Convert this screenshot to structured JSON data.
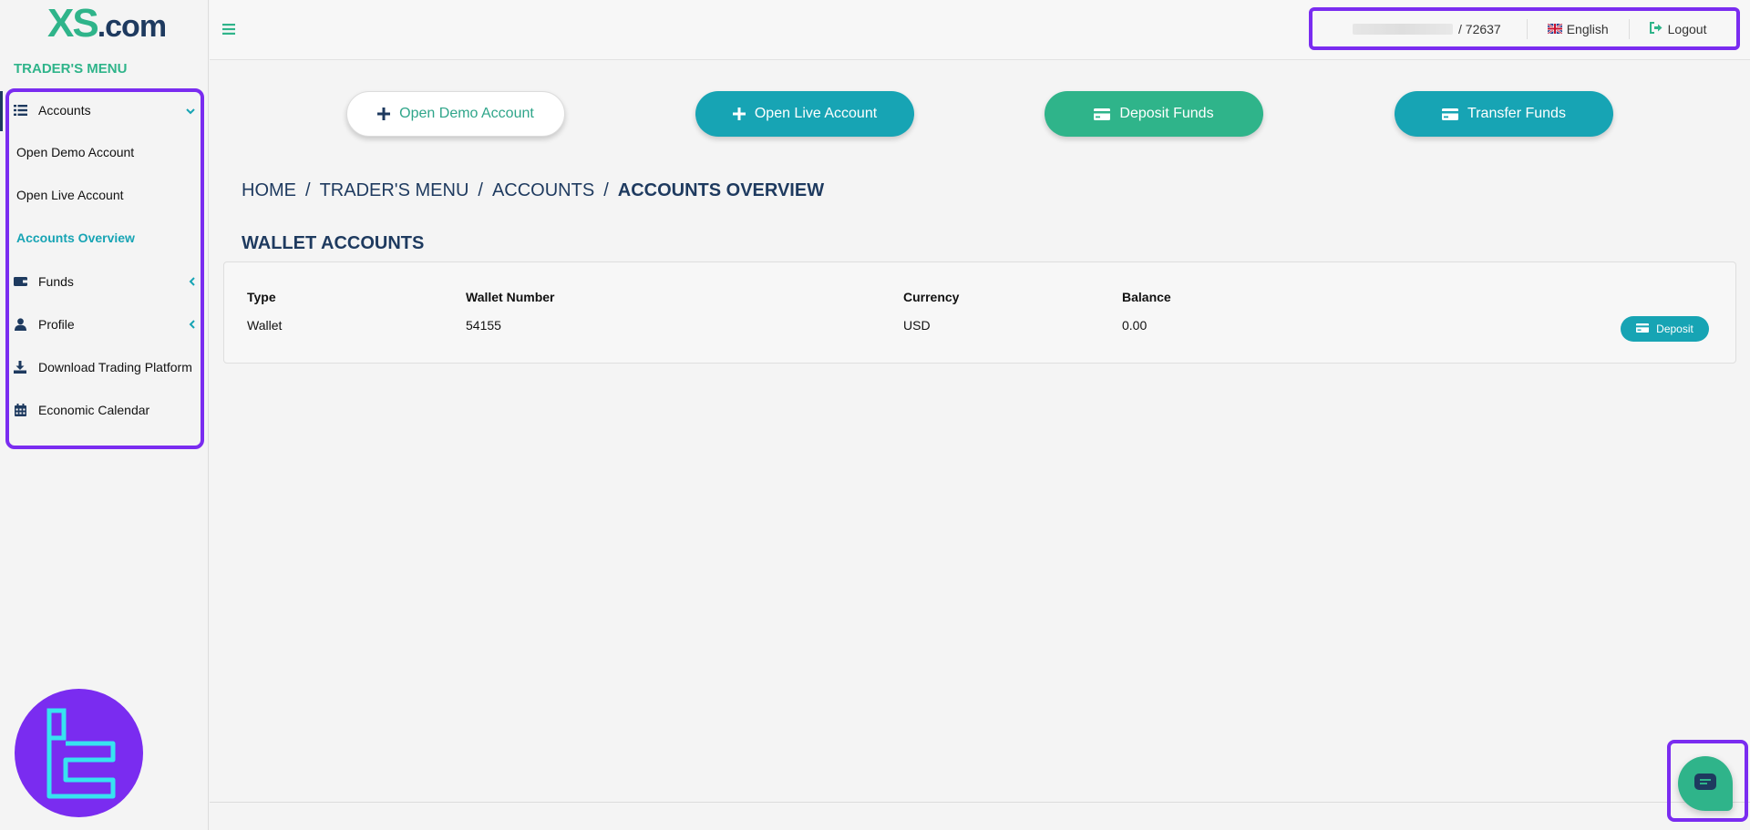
{
  "brand": {
    "logo_main": "XS",
    "logo_suffix": ".com"
  },
  "sidebar": {
    "title": "TRADER'S MENU",
    "accounts_label": "Accounts",
    "sub_items": [
      {
        "label": "Open Demo Account"
      },
      {
        "label": "Open Live Account"
      },
      {
        "label": "Accounts Overview"
      }
    ],
    "funds_label": "Funds",
    "profile_label": "Profile",
    "download_label": "Download Trading Platform",
    "calendar_label": "Economic Calendar"
  },
  "topbar": {
    "account_suffix": "/ 72637",
    "language": "English",
    "logout": "Logout"
  },
  "actions": {
    "open_demo": "Open Demo Account",
    "open_live": "Open Live Account",
    "deposit_funds": "Deposit Funds",
    "transfer_funds": "Transfer Funds"
  },
  "breadcrumb": {
    "home": "HOME",
    "traders_menu": "TRADER'S MENU",
    "accounts": "ACCOUNTS",
    "current": "ACCOUNTS OVERVIEW"
  },
  "wallet": {
    "section_title": "WALLET ACCOUNTS",
    "headers": {
      "type": "Type",
      "number": "Wallet Number",
      "currency": "Currency",
      "balance": "Balance"
    },
    "row": {
      "type": "Wallet",
      "number": "54155",
      "currency": "USD",
      "balance": "0.00"
    },
    "deposit_label": "Deposit"
  },
  "colors": {
    "brand_green": "#2fb48a",
    "brand_teal": "#17a4b4",
    "brand_navy": "#1e3a5f",
    "highlight_purple": "#7a2cf0"
  }
}
